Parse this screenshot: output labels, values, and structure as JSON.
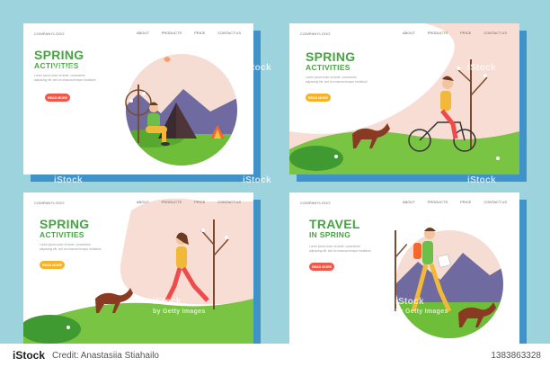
{
  "panels": [
    {
      "logo": "COMPANYLOGO",
      "nav": [
        "ABOUT",
        "PRODUCTS",
        "PRICE",
        "CONTACT US"
      ],
      "title_line1": "SPRING",
      "title_line2": "ACTIVITIES",
      "description": "Lorem ipsum dolor sit amet, consectetur adipiscing elit, sed do eiusmod tempor incididunt",
      "button": "READ MORE",
      "button_color": "#f0594a"
    },
    {
      "logo": "COMPANYLOGO",
      "nav": [
        "ABOUT",
        "PRODUCTS",
        "PRICE",
        "CONTACT US"
      ],
      "title_line1": "SPRING",
      "title_line2": "ACTIVITIES",
      "description": "Lorem ipsum dolor sit amet, consectetur adipiscing elit, sed do eiusmod tempor incididunt",
      "button": "READ MORE",
      "button_color": "#f5b32a"
    },
    {
      "logo": "COMPANYLOGO",
      "nav": [
        "ABOUT",
        "PRODUCTS",
        "PRICE",
        "CONTACT US"
      ],
      "title_line1": "SPRING",
      "title_line2": "ACTIVITIES",
      "description": "Lorem ipsum dolor sit amet, consectetur adipiscing elit, sed do eiusmod tempor incididunt",
      "button": "READ MORE",
      "button_color": "#f5b32a"
    },
    {
      "logo": "COMPANYLOGO",
      "nav": [
        "ABOUT",
        "PRODUCTS",
        "PRICE",
        "CONTACT US"
      ],
      "title_line1": "TRAVEL",
      "title_line2": "IN SPRING",
      "description": "Lorem ipsum dolor sit amet, consectetur adipiscing elit, sed do eiusmod tempor incididunt",
      "button": "READ MORE",
      "button_color": "#f0594a"
    }
  ],
  "watermark": "iStock",
  "credit_watermark": "by Getty Images",
  "bottom_bar": {
    "logo": "iStock",
    "credit": "Credit: Anastasiia Stiahailo",
    "image_id": "1383863328"
  },
  "colors": {
    "background": "#9dd3dd",
    "panel_shadow": "#3f93c9",
    "title_green": "#43a63f"
  }
}
